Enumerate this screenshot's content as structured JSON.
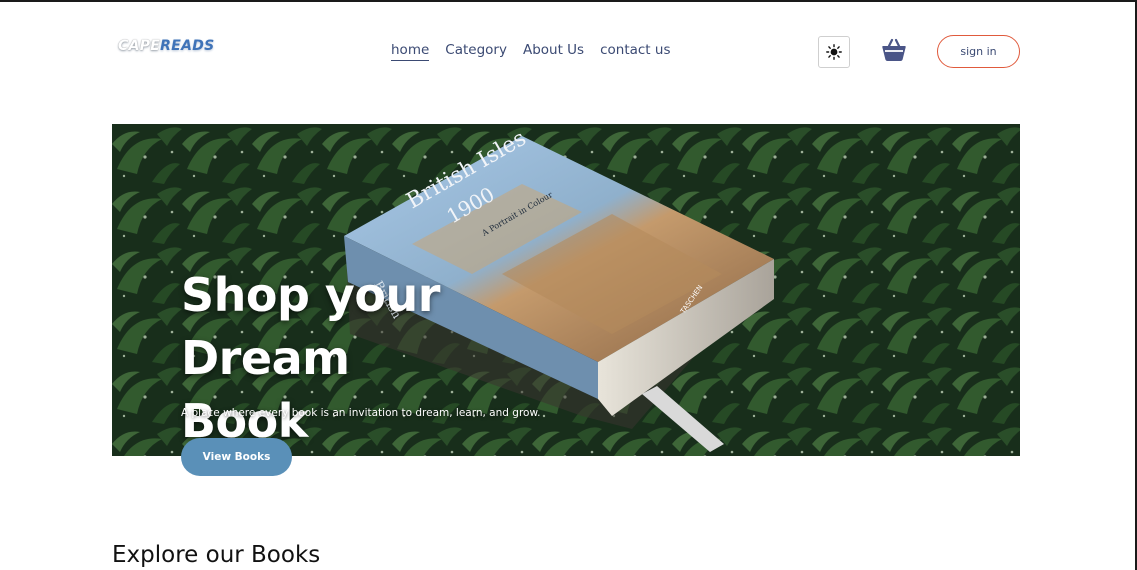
{
  "header": {
    "logo_part1": "CAPE",
    "logo_part2": "READS",
    "nav": [
      {
        "label": "home",
        "active": true
      },
      {
        "label": "Category",
        "active": false
      },
      {
        "label": "About Us",
        "active": false
      },
      {
        "label": "contact us",
        "active": false
      }
    ],
    "theme_icon": "sun-icon",
    "cart_icon": "basket-icon",
    "signin_label": "sign in"
  },
  "hero": {
    "title_line1": "Shop your Dream",
    "title_line2": "Book",
    "subtitle": "A place where every book is an invitation to dream, learn, and grow.",
    "button_label": "View Books",
    "book": {
      "title_line1": "British Isles",
      "title_line2": "1900",
      "subtitle": "A Portrait in Colour",
      "spine_text": "British",
      "publisher": "TASCHEN"
    }
  },
  "section": {
    "explore_title": "Explore our Books"
  },
  "colors": {
    "nav_text": "#3b4a73",
    "signin_border": "#e05a3c",
    "button_bg": "#5a90b8",
    "logo_accent": "#3f73b8"
  }
}
